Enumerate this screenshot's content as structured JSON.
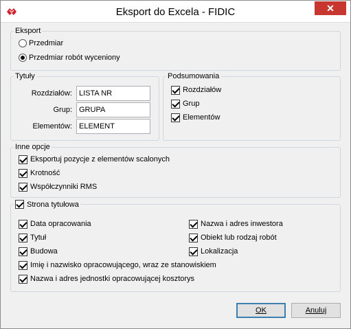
{
  "window": {
    "title": "Eksport do Excela - FIDIC",
    "close_glyph": "✕",
    "accent": "#c7372f"
  },
  "eksport": {
    "legend": "Eksport",
    "options": [
      {
        "label": "Przedmiar",
        "selected": false
      },
      {
        "label": "Przedmiar robót wyceniony",
        "selected": true
      }
    ]
  },
  "tytuly": {
    "legend": "Tytuły",
    "fields": [
      {
        "label": "Rozdziałów:",
        "value": "LISTA NR"
      },
      {
        "label": "Grup:",
        "value": "GRUPA"
      },
      {
        "label": "Elementów:",
        "value": "ELEMENT"
      }
    ]
  },
  "podsumowania": {
    "legend": "Podsumowania",
    "items": [
      {
        "label": "Rozdziałów",
        "checked": true
      },
      {
        "label": "Grup",
        "checked": true
      },
      {
        "label": "Elementów",
        "checked": true
      }
    ]
  },
  "inne_opcje": {
    "legend": "Inne opcje",
    "items": [
      {
        "label": "Eksportuj pozycje z elementów scalonych",
        "checked": true
      },
      {
        "label": "Krotność",
        "checked": true
      },
      {
        "label": "Współczynniki RMS",
        "checked": true
      }
    ]
  },
  "strona_tytulowa": {
    "legend": "Strona tytułowa",
    "checked": true,
    "left": [
      {
        "label": "Data opracowania",
        "checked": true
      },
      {
        "label": "Tytuł",
        "checked": true
      },
      {
        "label": "Budowa",
        "checked": true
      }
    ],
    "right": [
      {
        "label": "Nazwa i adres inwestora",
        "checked": true
      },
      {
        "label": "Obiekt lub rodzaj robót",
        "checked": true
      },
      {
        "label": "Lokalizacja",
        "checked": true
      }
    ],
    "full": [
      {
        "label": "Imię i nazwisko opracowującego, wraz ze stanowiskiem",
        "checked": true
      },
      {
        "label": "Nazwa i adres jednostki opracowującej kosztorys",
        "checked": true
      }
    ]
  },
  "buttons": {
    "ok": "OK",
    "cancel": "Anuluj"
  }
}
